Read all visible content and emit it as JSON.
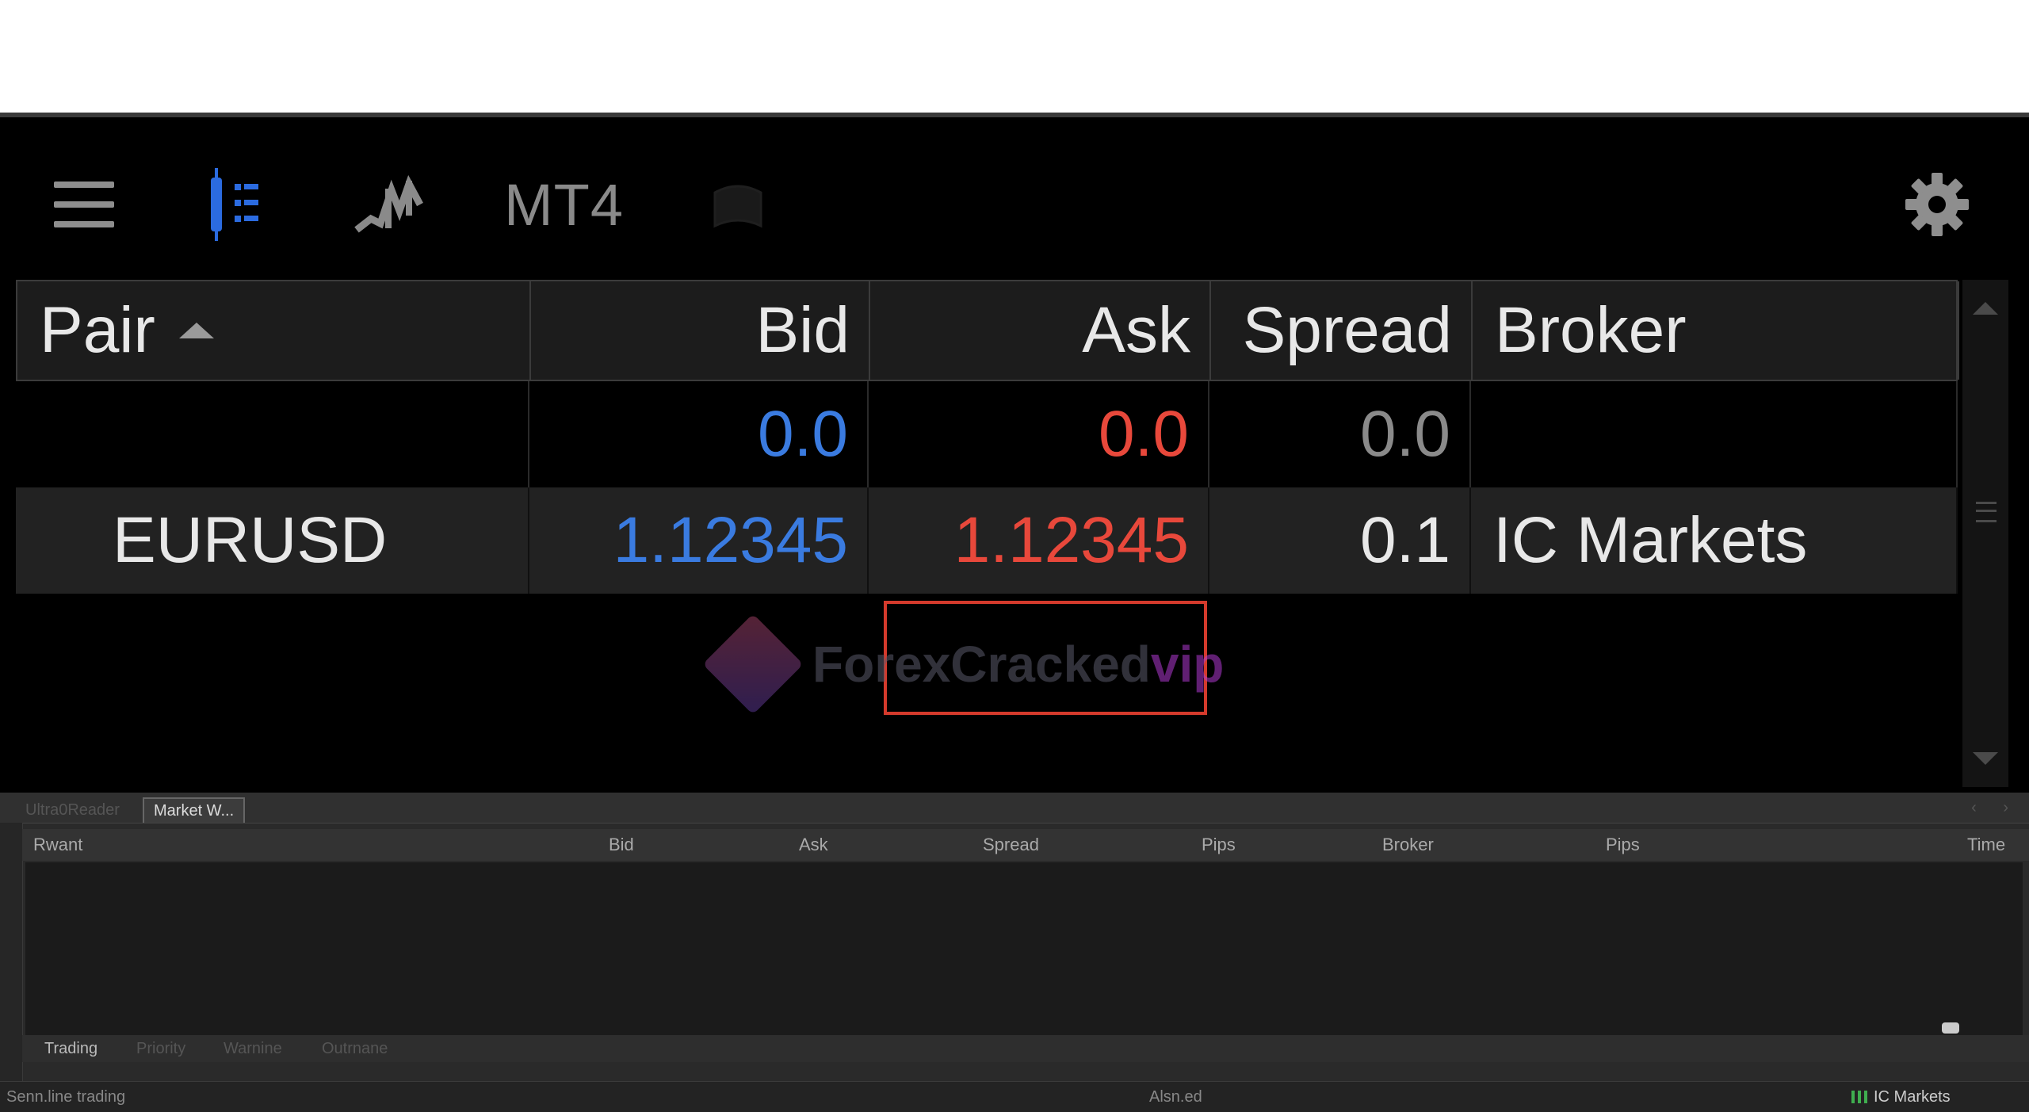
{
  "toolbar": {
    "mode_label": "MT4",
    "icons": [
      "menu-icon",
      "market-watch-icon",
      "chart-icon",
      "faded-icon",
      "gear-icon"
    ]
  },
  "table": {
    "headers": {
      "pair": "Pair",
      "bid": "Bid",
      "ask": "Ask",
      "spread": "Spread",
      "broker": "Broker"
    },
    "rows": [
      {
        "pair": "",
        "bid": "0.0",
        "ask": "0.0",
        "spread": "0.0",
        "broker": ""
      },
      {
        "pair": "EURUSD",
        "bid": "1.12345",
        "ask": "1.12345",
        "spread": "0.1",
        "broker": "IC Markets"
      }
    ]
  },
  "watermark": {
    "text": "ForexCracked",
    "suffix": "vip"
  },
  "panel": {
    "tabs": [
      "Ultra0Reader",
      "Market W..."
    ],
    "columns": [
      "Rwant",
      "Bid",
      "Ask",
      "Spread",
      "Pips",
      "Broker",
      "Pips",
      "Time"
    ],
    "bottom_tabs": [
      "Trading",
      "Priority",
      "Warnine",
      "Outrnane"
    ],
    "status_left": "Senn.line trading",
    "status_mid": "Alsn.ed",
    "status_broker": "IC Markets"
  },
  "colors": {
    "bid": "#3a7be0",
    "ask": "#e8483b",
    "highlight": "#d43a2c",
    "accent": "#2b6be0"
  }
}
